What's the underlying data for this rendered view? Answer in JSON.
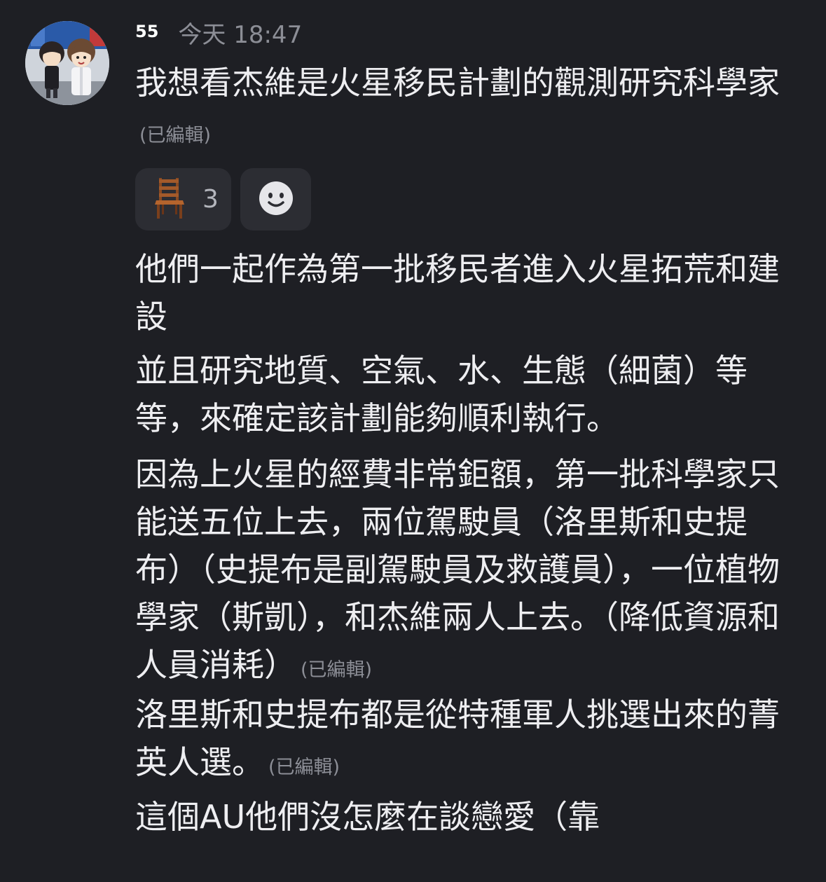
{
  "message": {
    "username": "55",
    "timestamp": "今天 18:47",
    "text": "我想看杰維是火星移民計劃的觀測研究科學家",
    "edited_label": "(已編輯)"
  },
  "reactions": [
    {
      "icon": "chair-icon",
      "count": "3"
    },
    {
      "icon": "add-reaction-smiley-icon"
    }
  ],
  "replies": [
    {
      "text": "他們一起作為第一批移民者進入火星拓荒和建設",
      "edited_label": ""
    },
    {
      "text": "並且研究地質、空氣、水、生態（細菌）等等，來確定該計劃能夠順利執行。",
      "edited_label": ""
    },
    {
      "text": "因為上火星的經費非常鉅額，第一批科學家只能送五位上去，兩位駕駛員（洛里斯和史提布）（史提布是副駕駛員及救護員），一位植物學家（斯凱），和杰維兩人上去。（降低資源和人員消耗）",
      "edited_label": "(已編輯)"
    },
    {
      "text": "洛里斯和史提布都是從特種軍人挑選出來的菁英人選。",
      "edited_label": "(已編輯)"
    },
    {
      "text": "這個AU他們沒怎麼在談戀愛（靠",
      "edited_label": ""
    }
  ],
  "colors": {
    "background": "#1e1f24",
    "text": "#eeeef1",
    "muted": "#8c8e96",
    "reaction_bg": "#2c2d33"
  }
}
